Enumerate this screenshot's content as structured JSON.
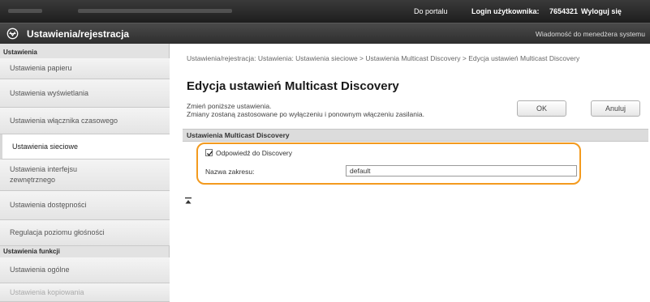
{
  "header": {
    "portal_link": "Do portalu",
    "login_label": "Login użytkownika:",
    "login_value": "7654321",
    "logout_link": "Wyloguj się"
  },
  "titlebar": {
    "title": "Ustawienia/rejestracja",
    "system_message": "Wiadomość do menedżera systemu"
  },
  "sidebar": {
    "section1_header": "Ustawienia",
    "items": [
      "Ustawienia papieru",
      "Ustawienia wyświetlania",
      "Ustawienia włącznika czasowego",
      "Ustawienia sieciowe",
      "Ustawienia interfejsu zewnętrznego",
      "Ustawienia dostępności",
      "Regulacja poziomu głośności"
    ],
    "section2_header": "Ustawienia funkcji",
    "items2": [
      "Ustawienia ogólne",
      "Ustawienia kopiowania"
    ]
  },
  "main": {
    "breadcrumb": "Ustawienia/rejestracja: Ustawienia: Ustawienia sieciowe > Ustawienia Multicast Discovery > Edycja ustawień Multicast Discovery",
    "page_title": "Edycja ustawień Multicast Discovery",
    "desc_line1": "Zmień poniższe ustawienia.",
    "desc_line2": "Zmiany zostaną zastosowane po wyłączeniu i ponownym włączeniu zasilania.",
    "ok_label": "OK",
    "cancel_label": "Anuluj",
    "section_title": "Ustawienia Multicast Discovery",
    "checkbox_label": "Odpowiedź do Discovery",
    "checkbox_checked": true,
    "scope_label": "Nazwa zakresu:",
    "scope_value": "default"
  },
  "colors": {
    "highlight": "#f39a1e",
    "topbar": "#2a2a2a",
    "sidebar": "#e2e2e2"
  }
}
